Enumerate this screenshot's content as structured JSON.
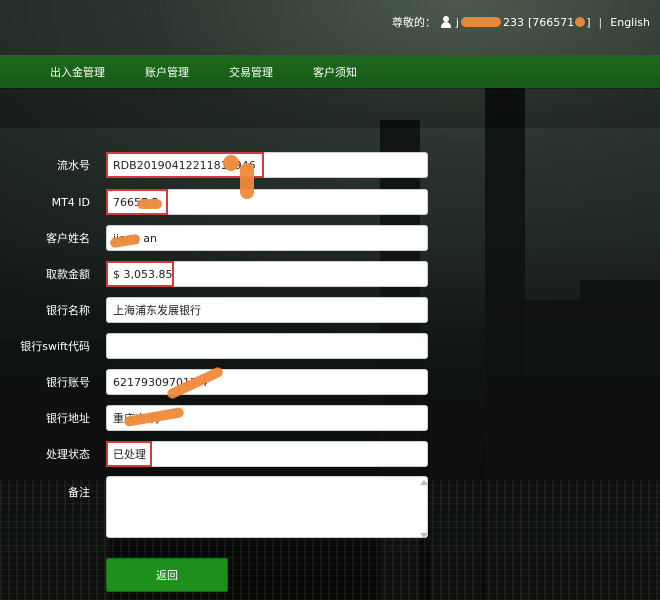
{
  "header": {
    "greeting": "尊敬的：",
    "username": "j",
    "username_suffix": "233",
    "account_id": "[766571",
    "account_id_end": "]",
    "language": "English",
    "separator": "|"
  },
  "nav": {
    "items": [
      "出入金管理",
      "账户管理",
      "交易管理",
      "客户须知"
    ]
  },
  "form": {
    "fields": [
      {
        "label": "流水号",
        "value": "RDB20190412211817946"
      },
      {
        "label": "MT4 ID",
        "value": "76657 5"
      },
      {
        "label": "客户姓名",
        "value": "jiang an"
      },
      {
        "label": "取款金额",
        "value": "$ 3,053.85"
      },
      {
        "label": "银行名称",
        "value": "上海浦东发展银行"
      },
      {
        "label": "银行swift代码",
        "value": ""
      },
      {
        "label": "银行账号",
        "value": "621793097017 4"
      },
      {
        "label": "银行地址",
        "value": "重庆市 行"
      },
      {
        "label": "处理状态",
        "value": "已处理"
      },
      {
        "label": "备注",
        "value": ""
      }
    ]
  },
  "actions": {
    "back_label": "返回"
  },
  "colors": {
    "nav_green": "#1c6a1c",
    "button_green": "#1c8f1c",
    "highlight_red": "#d23b3b",
    "redaction_orange": "#f08a3a"
  }
}
